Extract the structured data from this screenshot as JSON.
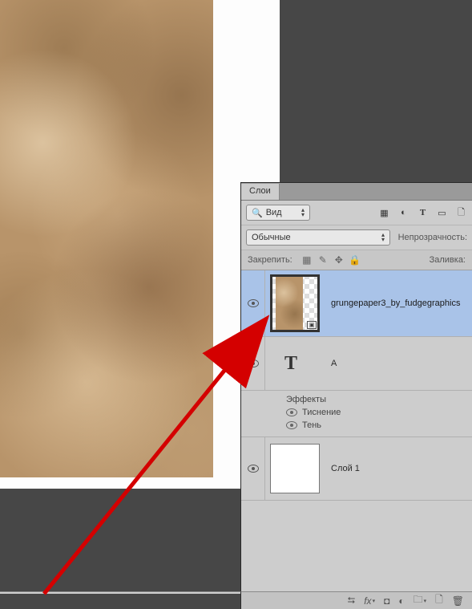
{
  "panel": {
    "tab_label": "Слои",
    "kind_label": "Вид",
    "blend_mode": "Обычные",
    "opacity_label": "Непрозрачность:",
    "lock_label": "Закрепить:",
    "fill_label": "Заливка:"
  },
  "layers": [
    {
      "name": "grungepaper3_by_fudgegraphics",
      "selected": true,
      "type": "image"
    },
    {
      "name": "A",
      "selected": false,
      "type": "text"
    },
    {
      "name": "Слой 1",
      "selected": false,
      "type": "blank"
    }
  ],
  "effects": {
    "title": "Эффекты",
    "items": [
      "Тиснение",
      "Тень"
    ]
  },
  "footer": {
    "icons": [
      "link",
      "fx",
      "mask",
      "adjust",
      "group",
      "new",
      "trash"
    ]
  }
}
